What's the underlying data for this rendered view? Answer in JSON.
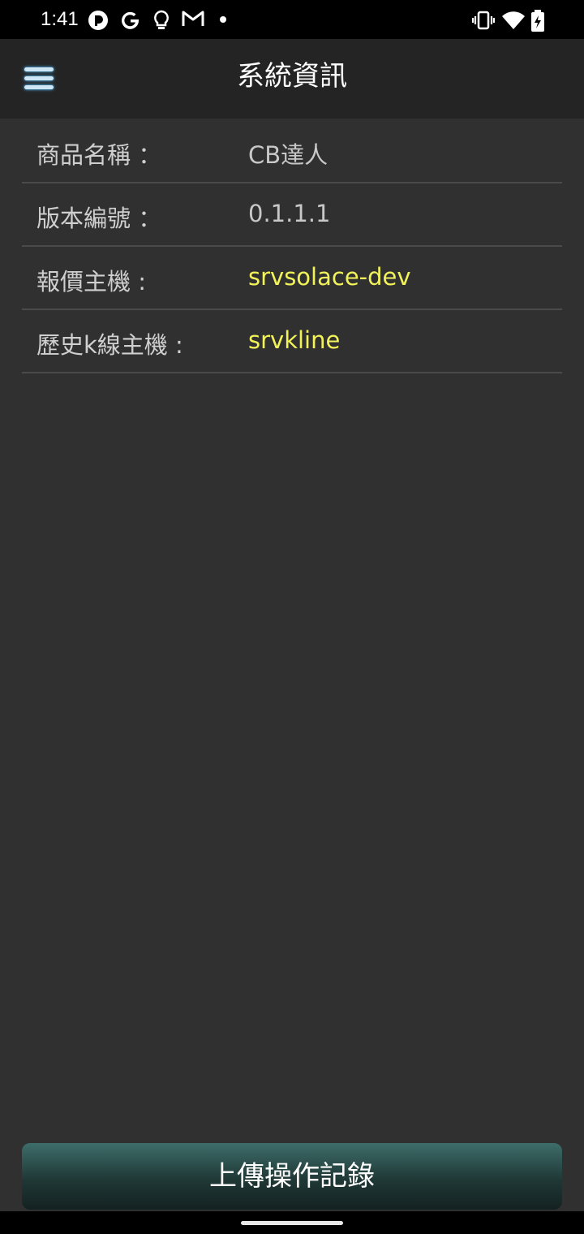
{
  "status_bar": {
    "time": "1:41",
    "left_icons": [
      "pocket-casts-icon",
      "google-icon",
      "lightbulb-icon",
      "gmail-icon",
      "dot-icon"
    ],
    "right_icons": [
      "vibrate-icon",
      "wifi-icon",
      "battery-charging-icon"
    ]
  },
  "app_bar": {
    "title": "系統資訊",
    "menu_icon": "hamburger-menu-icon",
    "menu_color": "#cfe7f5"
  },
  "info_rows": [
    {
      "label": "商品名稱 ：",
      "value": "CB達人",
      "value_color": "#c8c8c8"
    },
    {
      "label": "版本編號 ：",
      "value": "0.1.1.1",
      "value_color": "#c8c8c8"
    },
    {
      "label": "報價主機 :",
      "value": "srvsolace-dev",
      "value_color": "#f2f25a"
    },
    {
      "label": "歷史k線主機 :",
      "value": "srvkline",
      "value_color": "#f2f25a"
    }
  ],
  "upload_button": {
    "label": "上傳操作記錄"
  },
  "colors": {
    "background": "#303030",
    "app_bar": "#242424",
    "highlight_value": "#f2f25a",
    "button_top": "#3e6e6a",
    "button_bottom": "#142221"
  }
}
